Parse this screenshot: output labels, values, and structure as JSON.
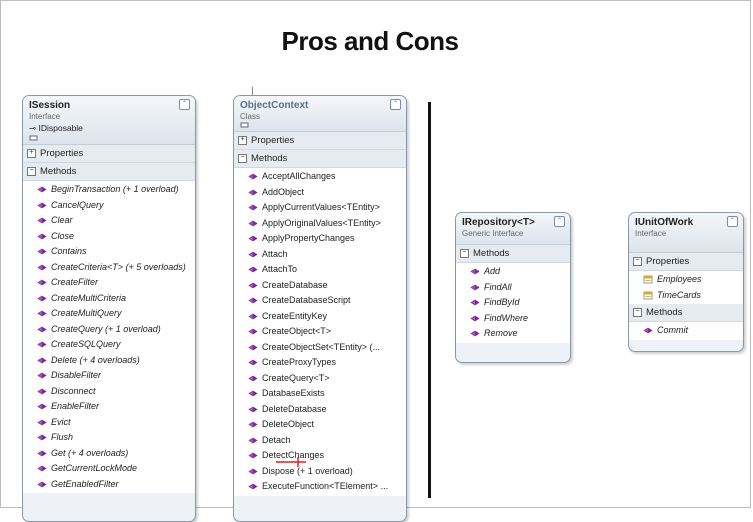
{
  "title": "Pros and Cons",
  "isession": {
    "name": "ISession",
    "kind": "Interface",
    "implements": "IDisposable",
    "sections": {
      "properties": "Properties",
      "methods": "Methods"
    },
    "methods": [
      "BeginTransaction (+ 1 overload)",
      "CancelQuery",
      "Clear",
      "Close",
      "Contains",
      "CreateCriteria<T> (+ 5 overloads)",
      "CreateFilter",
      "CreateMultiCriteria",
      "CreateMultiQuery",
      "CreateQuery (+ 1 overload)",
      "CreateSQLQuery",
      "Delete (+ 4 overloads)",
      "DisableFilter",
      "Disconnect",
      "EnableFilter",
      "Evict",
      "Flush",
      "Get (+ 4 overloads)",
      "GetCurrentLockMode",
      "GetEnabledFilter"
    ]
  },
  "objectcontext": {
    "name": "ObjectContext",
    "kind": "Class",
    "sections": {
      "properties": "Properties",
      "methods": "Methods"
    },
    "methods": [
      "AcceptAllChanges",
      "AddObject",
      "ApplyCurrentValues<TEntity>",
      "ApplyOriginalValues<TEntity>",
      "ApplyPropertyChanges",
      "Attach",
      "AttachTo",
      "CreateDatabase",
      "CreateDatabaseScript",
      "CreateEntityKey",
      "CreateObject<T>",
      "CreateObjectSet<TEntity> (...",
      "CreateProxyTypes",
      "CreateQuery<T>",
      "DatabaseExists",
      "DeleteDatabase",
      "DeleteObject",
      "Detach",
      "DetectChanges",
      "Dispose (+ 1 overload)",
      "ExecuteFunction<TElement> ..."
    ]
  },
  "irepository": {
    "name": "IRepository<T>",
    "kind": "Generic Interface",
    "sections": {
      "methods": "Methods"
    },
    "methods": [
      "Add",
      "FindAll",
      "FindById",
      "FindWhere",
      "Remove"
    ]
  },
  "iunitofwork": {
    "name": "IUnitOfWork",
    "kind": "Interface",
    "sections": {
      "properties": "Properties",
      "methods": "Methods"
    },
    "properties": [
      "Employees",
      "TimeCards"
    ],
    "methods": [
      "Commit"
    ]
  },
  "colors": {
    "method_icon": "#b04cc8",
    "property_icon": "#d8a73a",
    "box_border": "#8a97a8",
    "box_header": "#dde4ec",
    "divider": "#111111",
    "annotation": "#e02020"
  }
}
